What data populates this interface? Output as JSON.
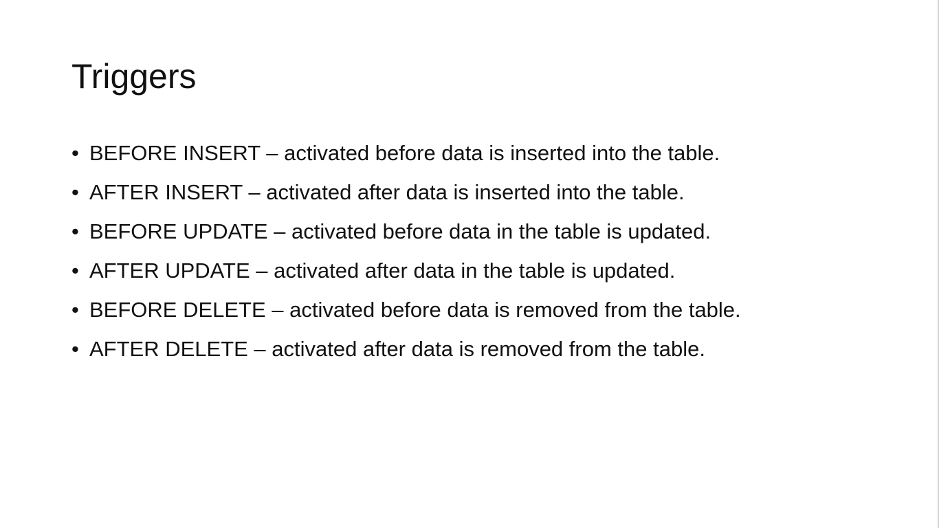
{
  "slide": {
    "title": "Triggers",
    "bullets": [
      "BEFORE INSERT – activated before data is inserted into the table.",
      "AFTER INSERT – activated after data is inserted into the table.",
      "BEFORE UPDATE – activated before data in the table is updated.",
      "AFTER UPDATE – activated after data in the table is updated.",
      "BEFORE DELETE – activated before data is removed from the table.",
      "AFTER DELETE – activated after data is removed from the table."
    ]
  }
}
